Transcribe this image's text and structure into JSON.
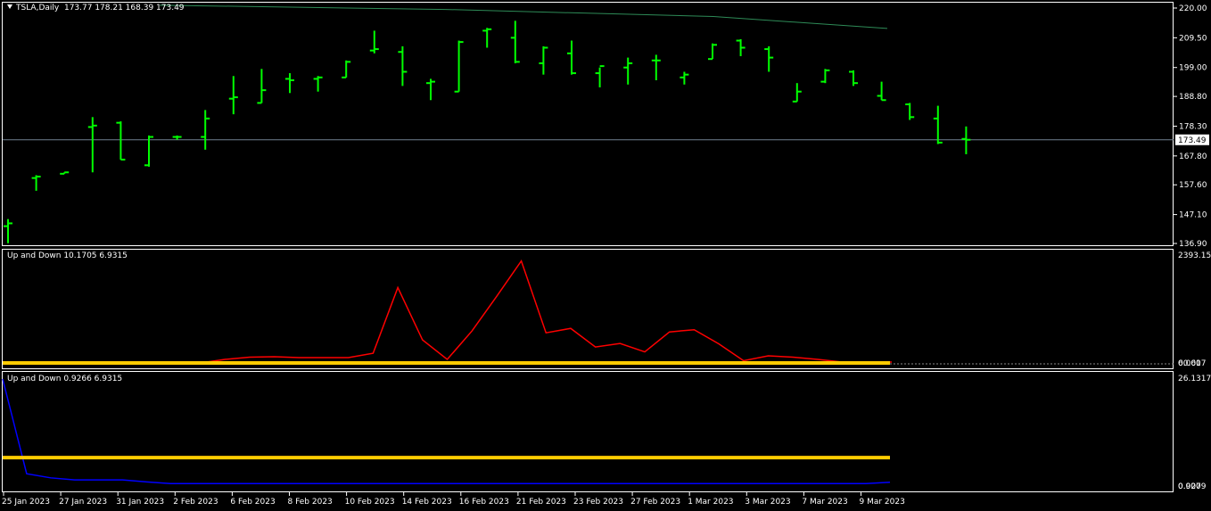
{
  "header": {
    "symbol": "TSLA,Daily",
    "ohlc": "173.77 178.21 168.39 173.49"
  },
  "price_badge": "173.49",
  "sub1": {
    "label": "Up and Down 10.1705 6.9315",
    "ticks": [
      "2393.156",
      "0.000",
      "60.617"
    ]
  },
  "sub2": {
    "label": "Up and Down 0.9266 6.9315",
    "ticks": [
      "26.1317",
      "0.000",
      "0.9279"
    ]
  },
  "x_labels": [
    "25 Jan 2023",
    "27 Jan 2023",
    "31 Jan 2023",
    "2 Feb 2023",
    "6 Feb 2023",
    "8 Feb 2023",
    "10 Feb 2023",
    "14 Feb 2023",
    "16 Feb 2023",
    "21 Feb 2023",
    "23 Feb 2023",
    "27 Feb 2023",
    "1 Mar 2023",
    "3 Mar 2023",
    "7 Mar 2023",
    "9 Mar 2023"
  ],
  "colors": {
    "bars": "#00ff00",
    "ma": "#2e8b57",
    "osc1": "#ff0000",
    "osc2": "#0000ff",
    "level": "#ffcc00",
    "frame": "#ffffff",
    "hline": "#708090"
  },
  "chart_data": [
    {
      "type": "ohlc",
      "title": "TSLA,Daily",
      "y_ticks": [
        220.0,
        209.5,
        199.0,
        188.8,
        178.3,
        167.8,
        157.6,
        147.1,
        136.9
      ],
      "ylim": [
        136.9,
        220.0
      ],
      "current_price": 173.49,
      "bars": [
        {
          "o": 143.0,
          "h": 145.5,
          "l": 137.0,
          "c": 144.0
        },
        {
          "o": 160.0,
          "h": 161.0,
          "l": 155.5,
          "c": 160.5
        },
        {
          "o": 161.5,
          "h": 162.0,
          "l": 161.5,
          "c": 162.0
        },
        {
          "o": 178.0,
          "h": 181.5,
          "l": 162.0,
          "c": 178.5
        },
        {
          "o": 179.5,
          "h": 180.0,
          "l": 166.5,
          "c": 166.5
        },
        {
          "o": 164.5,
          "h": 175.0,
          "l": 164.0,
          "c": 174.5
        },
        {
          "o": 174.5,
          "h": 175.0,
          "l": 173.5,
          "c": 174.5
        },
        {
          "o": 174.5,
          "h": 184.0,
          "l": 170.0,
          "c": 181.0
        },
        {
          "o": 188.0,
          "h": 196.0,
          "l": 182.5,
          "c": 188.5
        },
        {
          "o": 186.5,
          "h": 198.5,
          "l": 186.5,
          "c": 191.0
        },
        {
          "o": 195.0,
          "h": 197.0,
          "l": 190.0,
          "c": 194.5
        },
        {
          "o": 195.0,
          "h": 196.0,
          "l": 190.5,
          "c": 195.5
        },
        {
          "o": 195.5,
          "h": 201.5,
          "l": 195.5,
          "c": 201.0
        },
        {
          "o": 205.0,
          "h": 212.0,
          "l": 204.0,
          "c": 205.5
        },
        {
          "o": 204.5,
          "h": 206.5,
          "l": 192.5,
          "c": 197.5
        },
        {
          "o": 193.5,
          "h": 195.0,
          "l": 187.5,
          "c": 194.0
        },
        {
          "o": 190.5,
          "h": 208.5,
          "l": 190.5,
          "c": 208.0
        },
        {
          "o": 212.0,
          "h": 213.0,
          "l": 206.0,
          "c": 212.5
        },
        {
          "o": 209.5,
          "h": 215.5,
          "l": 200.5,
          "c": 201.0
        },
        {
          "o": 200.5,
          "h": 206.5,
          "l": 196.5,
          "c": 206.0
        },
        {
          "o": 204.0,
          "h": 208.5,
          "l": 196.5,
          "c": 197.0
        },
        {
          "o": 197.0,
          "h": 199.0,
          "l": 192.0,
          "c": 199.5
        },
        {
          "o": 199.0,
          "h": 202.5,
          "l": 193.0,
          "c": 200.5
        },
        {
          "o": 201.5,
          "h": 203.5,
          "l": 194.5,
          "c": 201.5
        },
        {
          "o": 195.5,
          "h": 197.5,
          "l": 193.0,
          "c": 196.5
        },
        {
          "o": 202.0,
          "h": 207.5,
          "l": 202.0,
          "c": 207.0
        },
        {
          "o": 208.5,
          "h": 209.0,
          "l": 203.0,
          "c": 206.0
        },
        {
          "o": 205.5,
          "h": 206.5,
          "l": 197.5,
          "c": 202.5
        },
        {
          "o": 187.0,
          "h": 193.5,
          "l": 187.0,
          "c": 190.5
        },
        {
          "o": 194.0,
          "h": 198.5,
          "l": 193.5,
          "c": 198.0
        },
        {
          "o": 197.5,
          "h": 198.0,
          "l": 192.5,
          "c": 193.5
        },
        {
          "o": 189.0,
          "h": 194.0,
          "l": 187.5,
          "c": 187.5
        },
        {
          "o": 186.0,
          "h": 186.5,
          "l": 180.5,
          "c": 181.5
        },
        {
          "o": 181.0,
          "h": 185.5,
          "l": 172.0,
          "c": 172.5
        },
        {
          "o": 173.8,
          "h": 178.2,
          "l": 168.4,
          "c": 173.5
        }
      ],
      "ma_line": [
        221.0,
        219.5,
        217.0,
        212.8
      ]
    },
    {
      "type": "line",
      "title": "Up and Down 10.1705 6.9315",
      "y_ticks": [
        2393.156,
        0.0,
        60.617
      ],
      "ylim": [
        0,
        2393.156
      ],
      "series": [
        {
          "values": [
            0,
            0,
            0,
            0,
            0,
            0,
            0,
            0,
            0,
            80,
            130,
            140,
            120,
            120,
            120,
            220,
            1700,
            520,
            80,
            720,
            1500,
            2300,
            680,
            780,
            360,
            440,
            250,
            700,
            750,
            430,
            50,
            160,
            130,
            80,
            20,
            20,
            20
          ]
        },
        {
          "values": [
            10,
            10,
            10,
            10,
            10,
            10,
            10,
            10,
            10,
            10,
            10,
            10,
            10,
            10,
            10,
            10,
            10,
            10,
            10,
            10,
            10,
            10,
            10,
            10,
            10,
            10,
            10,
            10,
            10,
            10,
            10,
            10,
            10,
            10,
            10,
            10,
            10
          ]
        }
      ]
    },
    {
      "type": "line",
      "title": "Up and Down 0.9266 6.9315",
      "y_ticks": [
        26.1317,
        0.0,
        0.9279
      ],
      "ylim": [
        0,
        26.1317
      ],
      "series": [
        {
          "values": [
            26.1317,
            3.0,
            2.0,
            1.5,
            1.5,
            1.5,
            1.0,
            0.6,
            0.6,
            0.6,
            0.6,
            0.6,
            0.6,
            0.6,
            0.6,
            0.6,
            0.6,
            0.6,
            0.6,
            0.6,
            0.6,
            0.6,
            0.6,
            0.6,
            0.6,
            0.6,
            0.6,
            0.6,
            0.6,
            0.6,
            0.6,
            0.6,
            0.6,
            0.6,
            0.6,
            0.6,
            0.6,
            0.9279
          ]
        },
        {
          "values": [
            6.9315,
            6.9315
          ]
        }
      ]
    }
  ]
}
